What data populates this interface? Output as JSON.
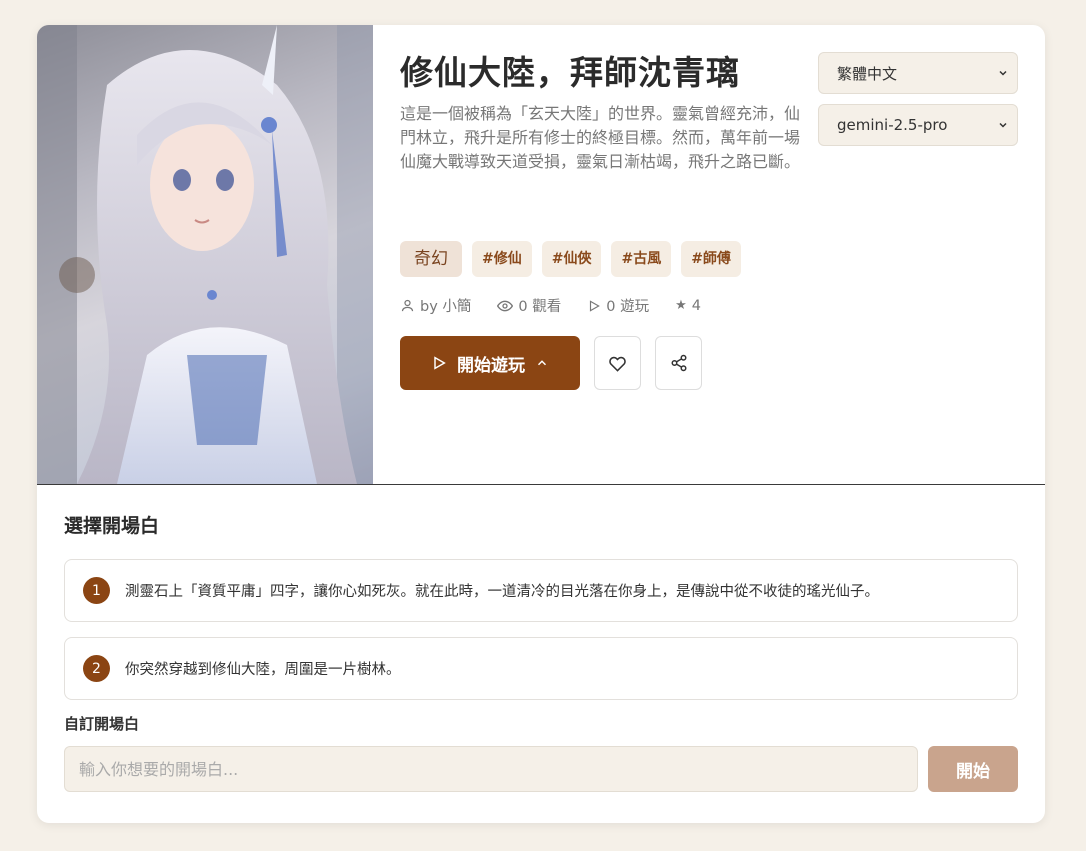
{
  "story": {
    "title": "修仙大陸，拜師沈青璃",
    "description": "這是一個被稱為「玄天大陸」的世界。靈氣曾經充沛，仙門林立，飛升是所有修士的終極目標。然而，萬年前一場仙魔大戰導致天道受損，靈氣日漸枯竭，飛升之路已斷。",
    "genre": "奇幻",
    "tags": [
      "#修仙",
      "#仙俠",
      "#古風",
      "#師傅"
    ],
    "author": "by 小簡",
    "views": "0 觀看",
    "plays": "0 遊玩",
    "rating": "4"
  },
  "actions": {
    "play_label": "開始遊玩"
  },
  "selects": {
    "language": "繁體中文",
    "model": "gemini-2.5-pro"
  },
  "openings": {
    "title": "選擇開場白",
    "items": [
      {
        "num": "1",
        "text": "測靈石上「資質平庸」四字，讓你心如死灰。就在此時，一道清冷的目光落在你身上，是傳說中從不收徒的瑤光仙子。"
      },
      {
        "num": "2",
        "text": "你突然穿越到修仙大陸，周圍是一片樹林。"
      }
    ],
    "custom_label": "自訂開場白",
    "custom_placeholder": "輸入你想要的開場白...",
    "start_label": "開始"
  },
  "colors": {
    "accent": "#8b4513",
    "background": "#f5f0e8",
    "start_button": "#c9a48d"
  }
}
